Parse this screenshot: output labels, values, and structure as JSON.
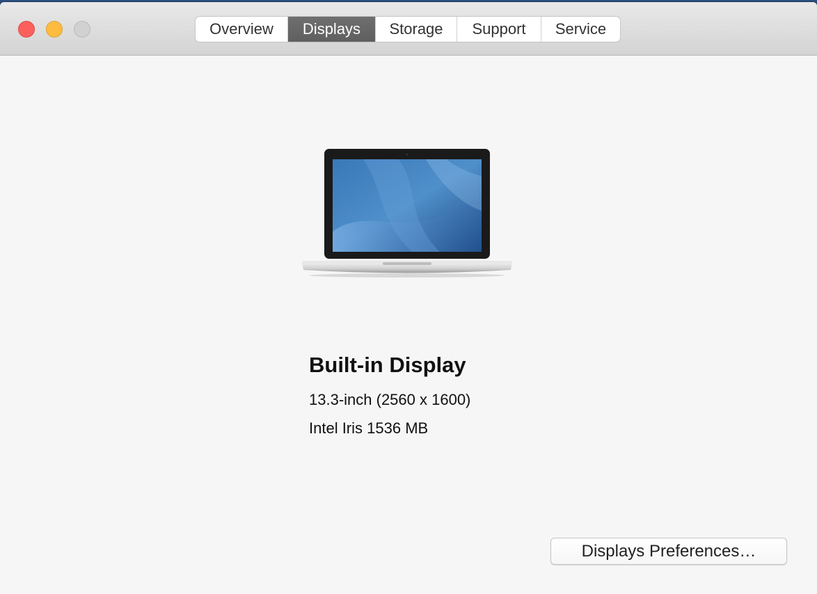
{
  "tabs": [
    {
      "label": "Overview",
      "active": false
    },
    {
      "label": "Displays",
      "active": true
    },
    {
      "label": "Storage",
      "active": false
    },
    {
      "label": "Support",
      "active": false
    },
    {
      "label": "Service",
      "active": false
    }
  ],
  "display": {
    "name": "Built-in Display",
    "size_resolution": "13.3-inch (2560 x 1600)",
    "graphics": "Intel Iris 1536 MB",
    "icon": "laptop-icon"
  },
  "buttons": {
    "preferences_label": "Displays Preferences…"
  },
  "colors": {
    "close": "#fc605c",
    "minimize": "#fdbc40",
    "zoom": "#d1d1d1",
    "active_tab": "#666666"
  }
}
